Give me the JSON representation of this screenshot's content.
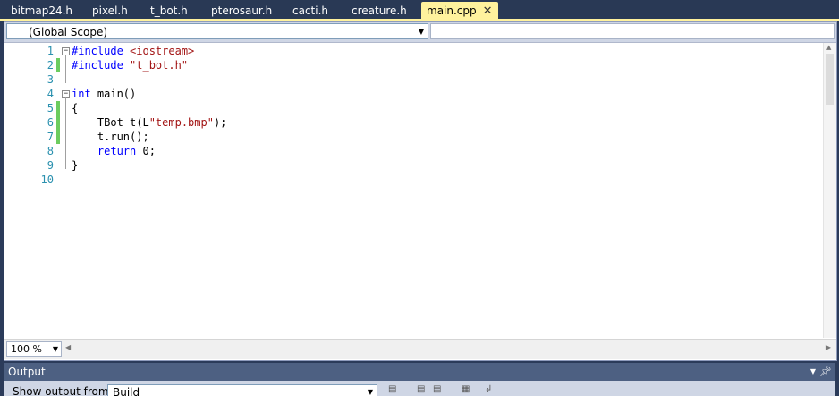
{
  "tabs": [
    {
      "label": "bitmap24.h"
    },
    {
      "label": "pixel.h"
    },
    {
      "label": "t_bot.h"
    },
    {
      "label": "pterosaur.h"
    },
    {
      "label": "cacti.h"
    },
    {
      "label": "creature.h"
    },
    {
      "label": "main.cpp",
      "active": true
    }
  ],
  "navbar": {
    "scope": "(Global Scope)",
    "member": ""
  },
  "code": {
    "lines": [
      {
        "n": "1",
        "tokens": [
          {
            "t": "#include ",
            "c": "kw"
          },
          {
            "t": "<iostream>",
            "c": "str"
          }
        ],
        "fold": true
      },
      {
        "n": "2",
        "tokens": [
          {
            "t": "#include ",
            "c": "kw"
          },
          {
            "t": "\"t_bot.h\"",
            "c": "str"
          }
        ],
        "changed": true
      },
      {
        "n": "3",
        "tokens": []
      },
      {
        "n": "4",
        "tokens": [
          {
            "t": "int",
            "c": "kw"
          },
          {
            "t": " main()",
            "c": ""
          }
        ],
        "fold": true
      },
      {
        "n": "5",
        "tokens": [
          {
            "t": "{",
            "c": ""
          }
        ],
        "changed": true
      },
      {
        "n": "6",
        "tokens": [
          {
            "t": "    TBot t(L",
            "c": ""
          },
          {
            "t": "\"temp.bmp\"",
            "c": "str"
          },
          {
            "t": ");",
            "c": ""
          }
        ],
        "changed": true
      },
      {
        "n": "7",
        "tokens": [
          {
            "t": "    t.run();",
            "c": ""
          }
        ],
        "changed": true
      },
      {
        "n": "8",
        "tokens": [
          {
            "t": "    ",
            "c": ""
          },
          {
            "t": "return",
            "c": "kw"
          },
          {
            "t": " 0;",
            "c": ""
          }
        ]
      },
      {
        "n": "9",
        "tokens": [
          {
            "t": "}",
            "c": ""
          }
        ]
      },
      {
        "n": "10",
        "tokens": []
      }
    ]
  },
  "zoom": "100 %",
  "output": {
    "title": "Output",
    "show_from_label": "Show output from:",
    "source": "Build"
  },
  "colors": {
    "tab_strip": "#293955",
    "active_tab": "#fff29d",
    "keyword": "#0000ff",
    "string": "#a31515",
    "line_number": "#2b91af",
    "changed_marker": "#6ccc5f"
  }
}
